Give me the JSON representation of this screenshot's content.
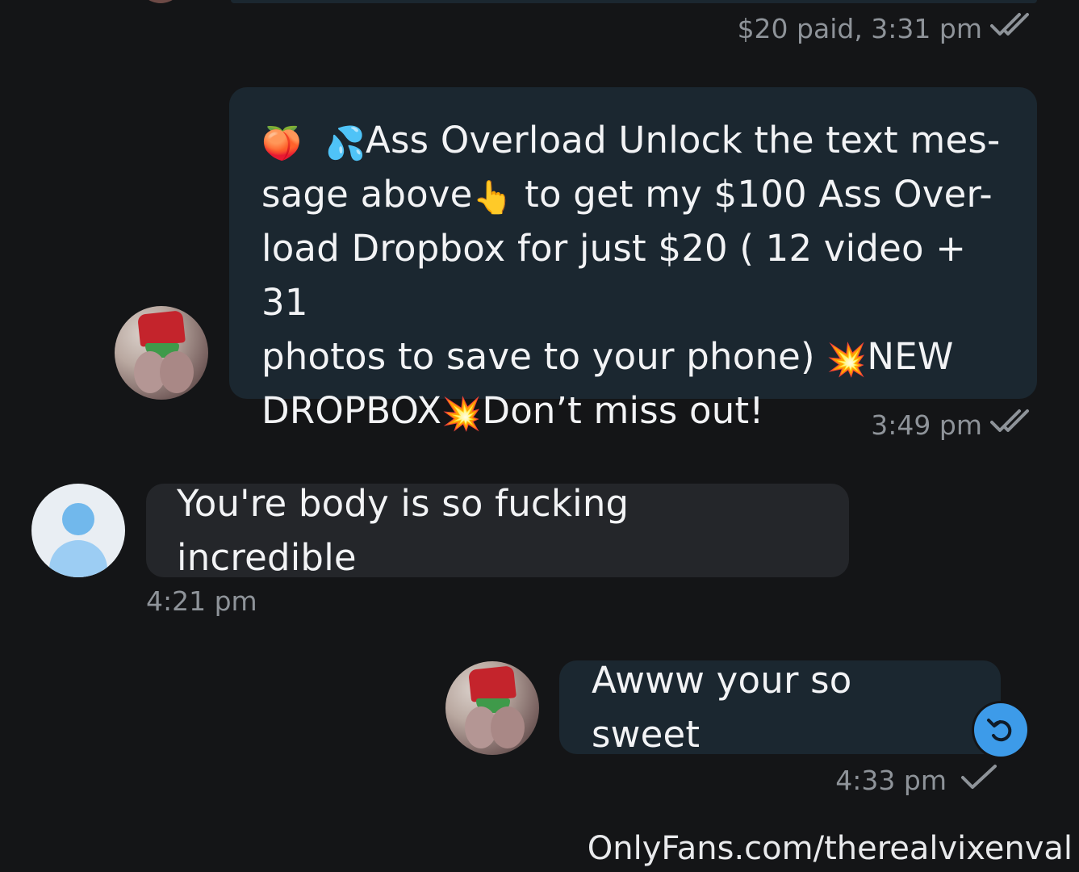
{
  "chat": {
    "top_meta": "$20 paid, 3:31 pm",
    "messages": [
      {
        "direction": "outgoing",
        "emoji_start": "🍑",
        "emoji_sweat": "💦",
        "text_1": "Ass Overload Unlock the text mes-",
        "text_2": "sage above",
        "emoji_point": "👆",
        "text_3": "to get my $100 Ass Over-",
        "text_4": "load Dropbox for just $20 ( 12 video + 31",
        "text_5": "photos to save to your phone)",
        "emoji_boom": "💥",
        "text_6": "NEW",
        "text_7": "DROPBOX",
        "text_8": "Don’t miss out!",
        "time": "3:49 pm",
        "status": "read"
      },
      {
        "direction": "incoming",
        "text": "You're body is so fucking incredible",
        "time": "4:21 pm"
      },
      {
        "direction": "outgoing",
        "text": "Awww your so sweet",
        "time": "4:33 pm",
        "status": "sent"
      }
    ]
  },
  "icons": {
    "double_check": "double-check-icon",
    "single_check": "check-icon",
    "undo": "undo-icon"
  },
  "colors": {
    "background": "#141517",
    "outgoing_bubble": "#1b2730",
    "incoming_bubble": "#24262a",
    "meta_text": "#8e9399",
    "accent": "#3d9be9"
  },
  "watermark": "OnlyFans.com/therealvixenval"
}
